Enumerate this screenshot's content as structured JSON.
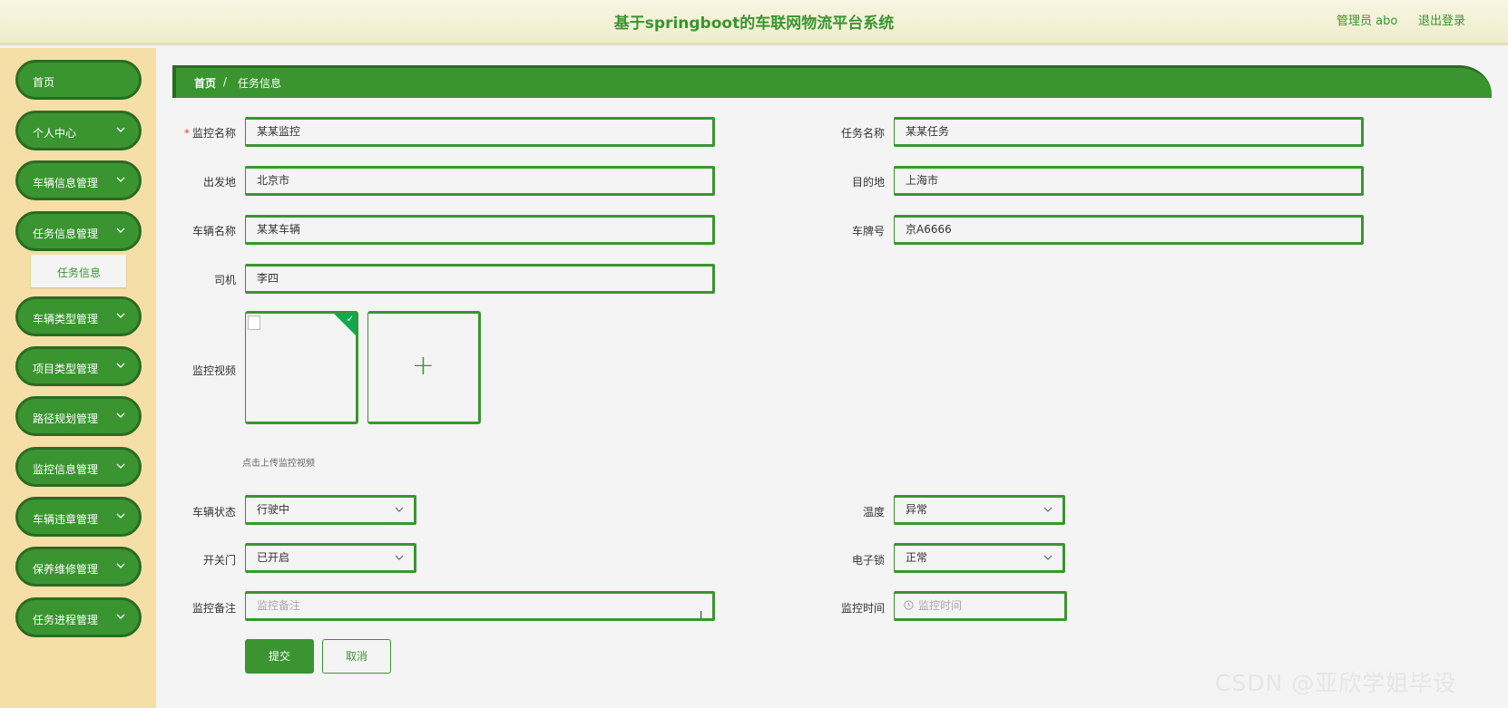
{
  "header": {
    "title": "基于springboot的车联网物流平台系统",
    "user": "管理员 abo",
    "logout": "退出登录"
  },
  "sidebar": {
    "items": [
      {
        "label": "首页",
        "has_children": false
      },
      {
        "label": "个人中心",
        "has_children": true
      },
      {
        "label": "车辆信息管理",
        "has_children": true
      },
      {
        "label": "任务信息管理",
        "has_children": true
      },
      {
        "label": "车辆类型管理",
        "has_children": true
      },
      {
        "label": "项目类型管理",
        "has_children": true
      },
      {
        "label": "路径规划管理",
        "has_children": true
      },
      {
        "label": "监控信息管理",
        "has_children": true
      },
      {
        "label": "车辆违章管理",
        "has_children": true
      },
      {
        "label": "保养维修管理",
        "has_children": true
      },
      {
        "label": "任务进程管理",
        "has_children": true
      }
    ],
    "submenu": {
      "label": "任务信息"
    }
  },
  "breadcrumb": {
    "home": "首页",
    "separator": "/",
    "current": "任务信息"
  },
  "form": {
    "monitor_name": {
      "label": "监控名称",
      "required_mark": "*",
      "value": "某某监控"
    },
    "task_name": {
      "label": "任务名称",
      "value": "某某任务"
    },
    "origin": {
      "label": "出发地",
      "value": "北京市"
    },
    "destination": {
      "label": "目的地",
      "value": "上海市"
    },
    "vehicle_name": {
      "label": "车辆名称",
      "value": "某某车辆"
    },
    "plate_number": {
      "label": "车牌号",
      "value": "京A6666"
    },
    "driver": {
      "label": "司机",
      "value": "李四"
    },
    "monitor_video": {
      "label": "监控视频",
      "hint": "点击上传监控视频",
      "check_icon": "✓",
      "add_icon": "+"
    },
    "vehicle_status": {
      "label": "车辆状态",
      "value": "行驶中"
    },
    "temperature": {
      "label": "温度",
      "value": "异常"
    },
    "door_switch": {
      "label": "开关门",
      "value": "已开启"
    },
    "electronic_lock": {
      "label": "电子锁",
      "value": "正常"
    },
    "monitor_remark": {
      "label": "监控备注",
      "placeholder": "监控备注"
    },
    "monitor_time": {
      "label": "监控时间",
      "placeholder": "监控时间"
    }
  },
  "buttons": {
    "submit": "提交",
    "cancel": "取消"
  },
  "watermark": "CSDN @亚欣学姐毕设",
  "colors": {
    "primary": "#3a9530",
    "sidebar_bg": "#f5dfa7",
    "header_bg": "#f7f5e2",
    "page_bg": "#f4f4f4"
  }
}
